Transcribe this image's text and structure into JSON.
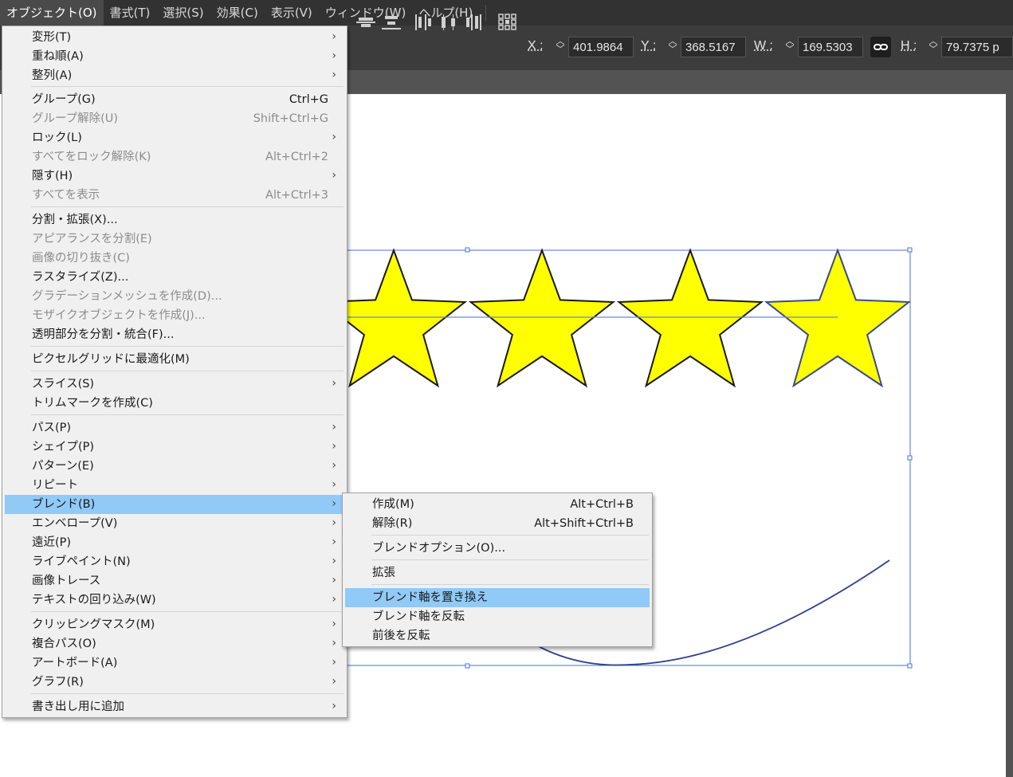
{
  "menubar": {
    "items": [
      "オブジェクト(O)",
      "書式(T)",
      "選択(S)",
      "効果(C)",
      "表示(V)",
      "ウィンドウ(W)",
      "ヘルプ(H)"
    ],
    "active_index": 0
  },
  "control_bar": {
    "x_label": "X :",
    "x_value": "401.9864",
    "y_label": "Y :",
    "y_value": "368.5167",
    "w_label": "W :",
    "w_value": "169.5303",
    "h_label": "H :",
    "h_value": "79.7375 p",
    "link_icon": "link-icon"
  },
  "object_menu": {
    "items": [
      {
        "label": "変形(T)",
        "shortcut": "",
        "submenu": true,
        "disabled": false
      },
      {
        "label": "重ね順(A)",
        "shortcut": "",
        "submenu": true,
        "disabled": false
      },
      {
        "label": "整列(A)",
        "shortcut": "",
        "submenu": true,
        "disabled": false
      },
      {
        "label": "グループ(G)",
        "shortcut": "Ctrl+G",
        "submenu": false,
        "disabled": false
      },
      {
        "label": "グループ解除(U)",
        "shortcut": "Shift+Ctrl+G",
        "submenu": false,
        "disabled": true
      },
      {
        "label": "ロック(L)",
        "shortcut": "",
        "submenu": true,
        "disabled": false
      },
      {
        "label": "すべてをロック解除(K)",
        "shortcut": "Alt+Ctrl+2",
        "submenu": false,
        "disabled": true
      },
      {
        "label": "隠す(H)",
        "shortcut": "",
        "submenu": true,
        "disabled": false
      },
      {
        "label": "すべてを表示",
        "shortcut": "Alt+Ctrl+3",
        "submenu": false,
        "disabled": true
      },
      {
        "label": "分割・拡張(X)...",
        "shortcut": "",
        "submenu": false,
        "disabled": false
      },
      {
        "label": "アピアランスを分割(E)",
        "shortcut": "",
        "submenu": false,
        "disabled": true
      },
      {
        "label": "画像の切り抜き(C)",
        "shortcut": "",
        "submenu": false,
        "disabled": true
      },
      {
        "label": "ラスタライズ(Z)...",
        "shortcut": "",
        "submenu": false,
        "disabled": false
      },
      {
        "label": "グラデーションメッシュを作成(D)...",
        "shortcut": "",
        "submenu": false,
        "disabled": true
      },
      {
        "label": "モザイクオブジェクトを作成(J)...",
        "shortcut": "",
        "submenu": false,
        "disabled": true
      },
      {
        "label": "透明部分を分割・統合(F)...",
        "shortcut": "",
        "submenu": false,
        "disabled": false
      },
      {
        "label": "ピクセルグリッドに最適化(M)",
        "shortcut": "",
        "submenu": false,
        "disabled": false
      },
      {
        "label": "スライス(S)",
        "shortcut": "",
        "submenu": true,
        "disabled": false
      },
      {
        "label": "トリムマークを作成(C)",
        "shortcut": "",
        "submenu": false,
        "disabled": false
      },
      {
        "label": "パス(P)",
        "shortcut": "",
        "submenu": true,
        "disabled": false
      },
      {
        "label": "シェイプ(P)",
        "shortcut": "",
        "submenu": true,
        "disabled": false
      },
      {
        "label": "パターン(E)",
        "shortcut": "",
        "submenu": true,
        "disabled": false
      },
      {
        "label": "リピート",
        "shortcut": "",
        "submenu": true,
        "disabled": false
      },
      {
        "label": "ブレンド(B)",
        "shortcut": "",
        "submenu": true,
        "disabled": false,
        "highlighted": true
      },
      {
        "label": "エンベロープ(V)",
        "shortcut": "",
        "submenu": true,
        "disabled": false
      },
      {
        "label": "遠近(P)",
        "shortcut": "",
        "submenu": true,
        "disabled": false
      },
      {
        "label": "ライブペイント(N)",
        "shortcut": "",
        "submenu": true,
        "disabled": false
      },
      {
        "label": "画像トレース",
        "shortcut": "",
        "submenu": true,
        "disabled": false
      },
      {
        "label": "テキストの回り込み(W)",
        "shortcut": "",
        "submenu": true,
        "disabled": false
      },
      {
        "label": "クリッピングマスク(M)",
        "shortcut": "",
        "submenu": true,
        "disabled": false
      },
      {
        "label": "複合パス(O)",
        "shortcut": "",
        "submenu": true,
        "disabled": false
      },
      {
        "label": "アートボード(A)",
        "shortcut": "",
        "submenu": true,
        "disabled": false
      },
      {
        "label": "グラフ(R)",
        "shortcut": "",
        "submenu": true,
        "disabled": false
      },
      {
        "label": "書き出し用に追加",
        "shortcut": "",
        "submenu": true,
        "disabled": false
      }
    ]
  },
  "blend_submenu": {
    "items": [
      {
        "label": "作成(M)",
        "shortcut": "Alt+Ctrl+B",
        "disabled": false
      },
      {
        "label": "解除(R)",
        "shortcut": "Alt+Shift+Ctrl+B",
        "disabled": false
      },
      {
        "label": "ブレンドオプション(O)...",
        "shortcut": "",
        "disabled": false
      },
      {
        "label": "拡張",
        "shortcut": "",
        "disabled": false
      },
      {
        "label": "ブレンド軸を置き換え",
        "shortcut": "",
        "disabled": false,
        "highlighted": true
      },
      {
        "label": "ブレンド軸を反転",
        "shortcut": "",
        "disabled": false
      },
      {
        "label": "前後を反転",
        "shortcut": "",
        "disabled": false
      }
    ]
  },
  "colors": {
    "star_fill": "#ffff00",
    "selection": "#4a6fd6",
    "menu_highlight": "#91c9f7",
    "menubar_bg": "#323232"
  }
}
